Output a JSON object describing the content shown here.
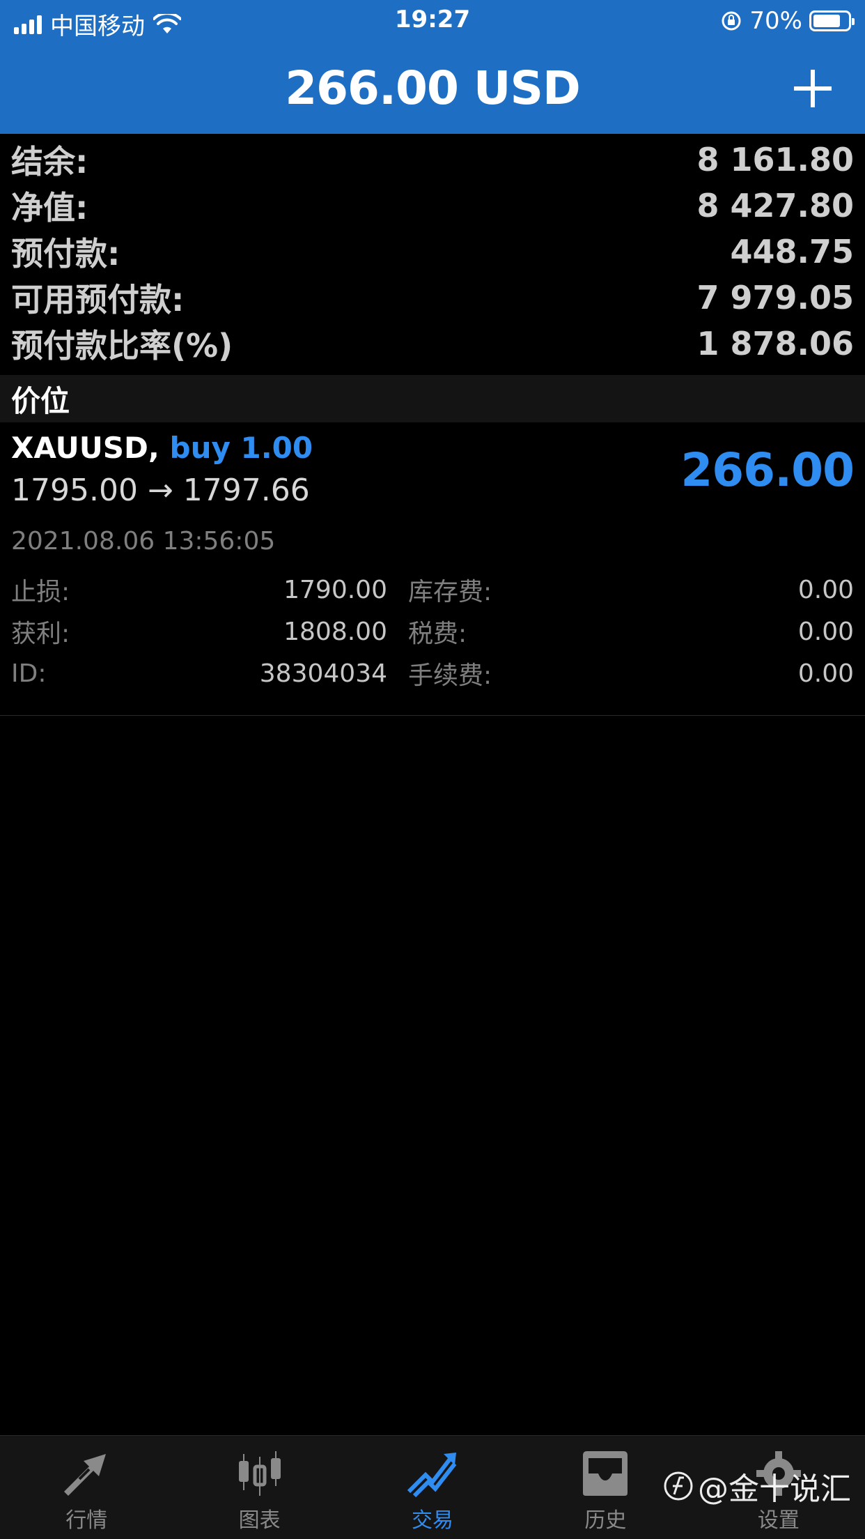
{
  "status_bar": {
    "carrier": "中国移动",
    "time": "19:27",
    "battery_text": "70%"
  },
  "header": {
    "title": "266.00 USD"
  },
  "summary": [
    {
      "label": "结余:",
      "value": "8 161.80"
    },
    {
      "label": "净值:",
      "value": "8 427.80"
    },
    {
      "label": "预付款:",
      "value": "448.75"
    },
    {
      "label": "可用预付款:",
      "value": "7 979.05"
    },
    {
      "label": "预付款比率(%)",
      "value": "1 878.06"
    }
  ],
  "section": {
    "title": "价位"
  },
  "position": {
    "symbol": "XAUUSD,",
    "side": "buy 1.00",
    "price_change": "1795.00 → 1797.66",
    "profit": "266.00",
    "open_time": "2021.08.06 13:56:05",
    "details": [
      {
        "l1": "止损:",
        "v1": "1790.00",
        "l2": "库存费:",
        "v2": "0.00"
      },
      {
        "l1": "获利:",
        "v1": "1808.00",
        "l2": "税费:",
        "v2": "0.00"
      },
      {
        "l1": "ID:",
        "v1": "38304034",
        "l2": "手续费:",
        "v2": "0.00"
      }
    ]
  },
  "tabs": [
    {
      "label": "行情",
      "icon": "quotes-arrows-icon",
      "active": false
    },
    {
      "label": "图表",
      "icon": "candlestick-icon",
      "active": false
    },
    {
      "label": "交易",
      "icon": "trade-trend-icon",
      "active": true
    },
    {
      "label": "历史",
      "icon": "history-inbox-icon",
      "active": false
    },
    {
      "label": "设置",
      "icon": "gear-icon",
      "active": false
    }
  ],
  "watermark": "@金十说汇",
  "colors": {
    "header_blue": "#1e6fc4",
    "accent_blue": "#2f8cf0",
    "background": "#000000"
  }
}
